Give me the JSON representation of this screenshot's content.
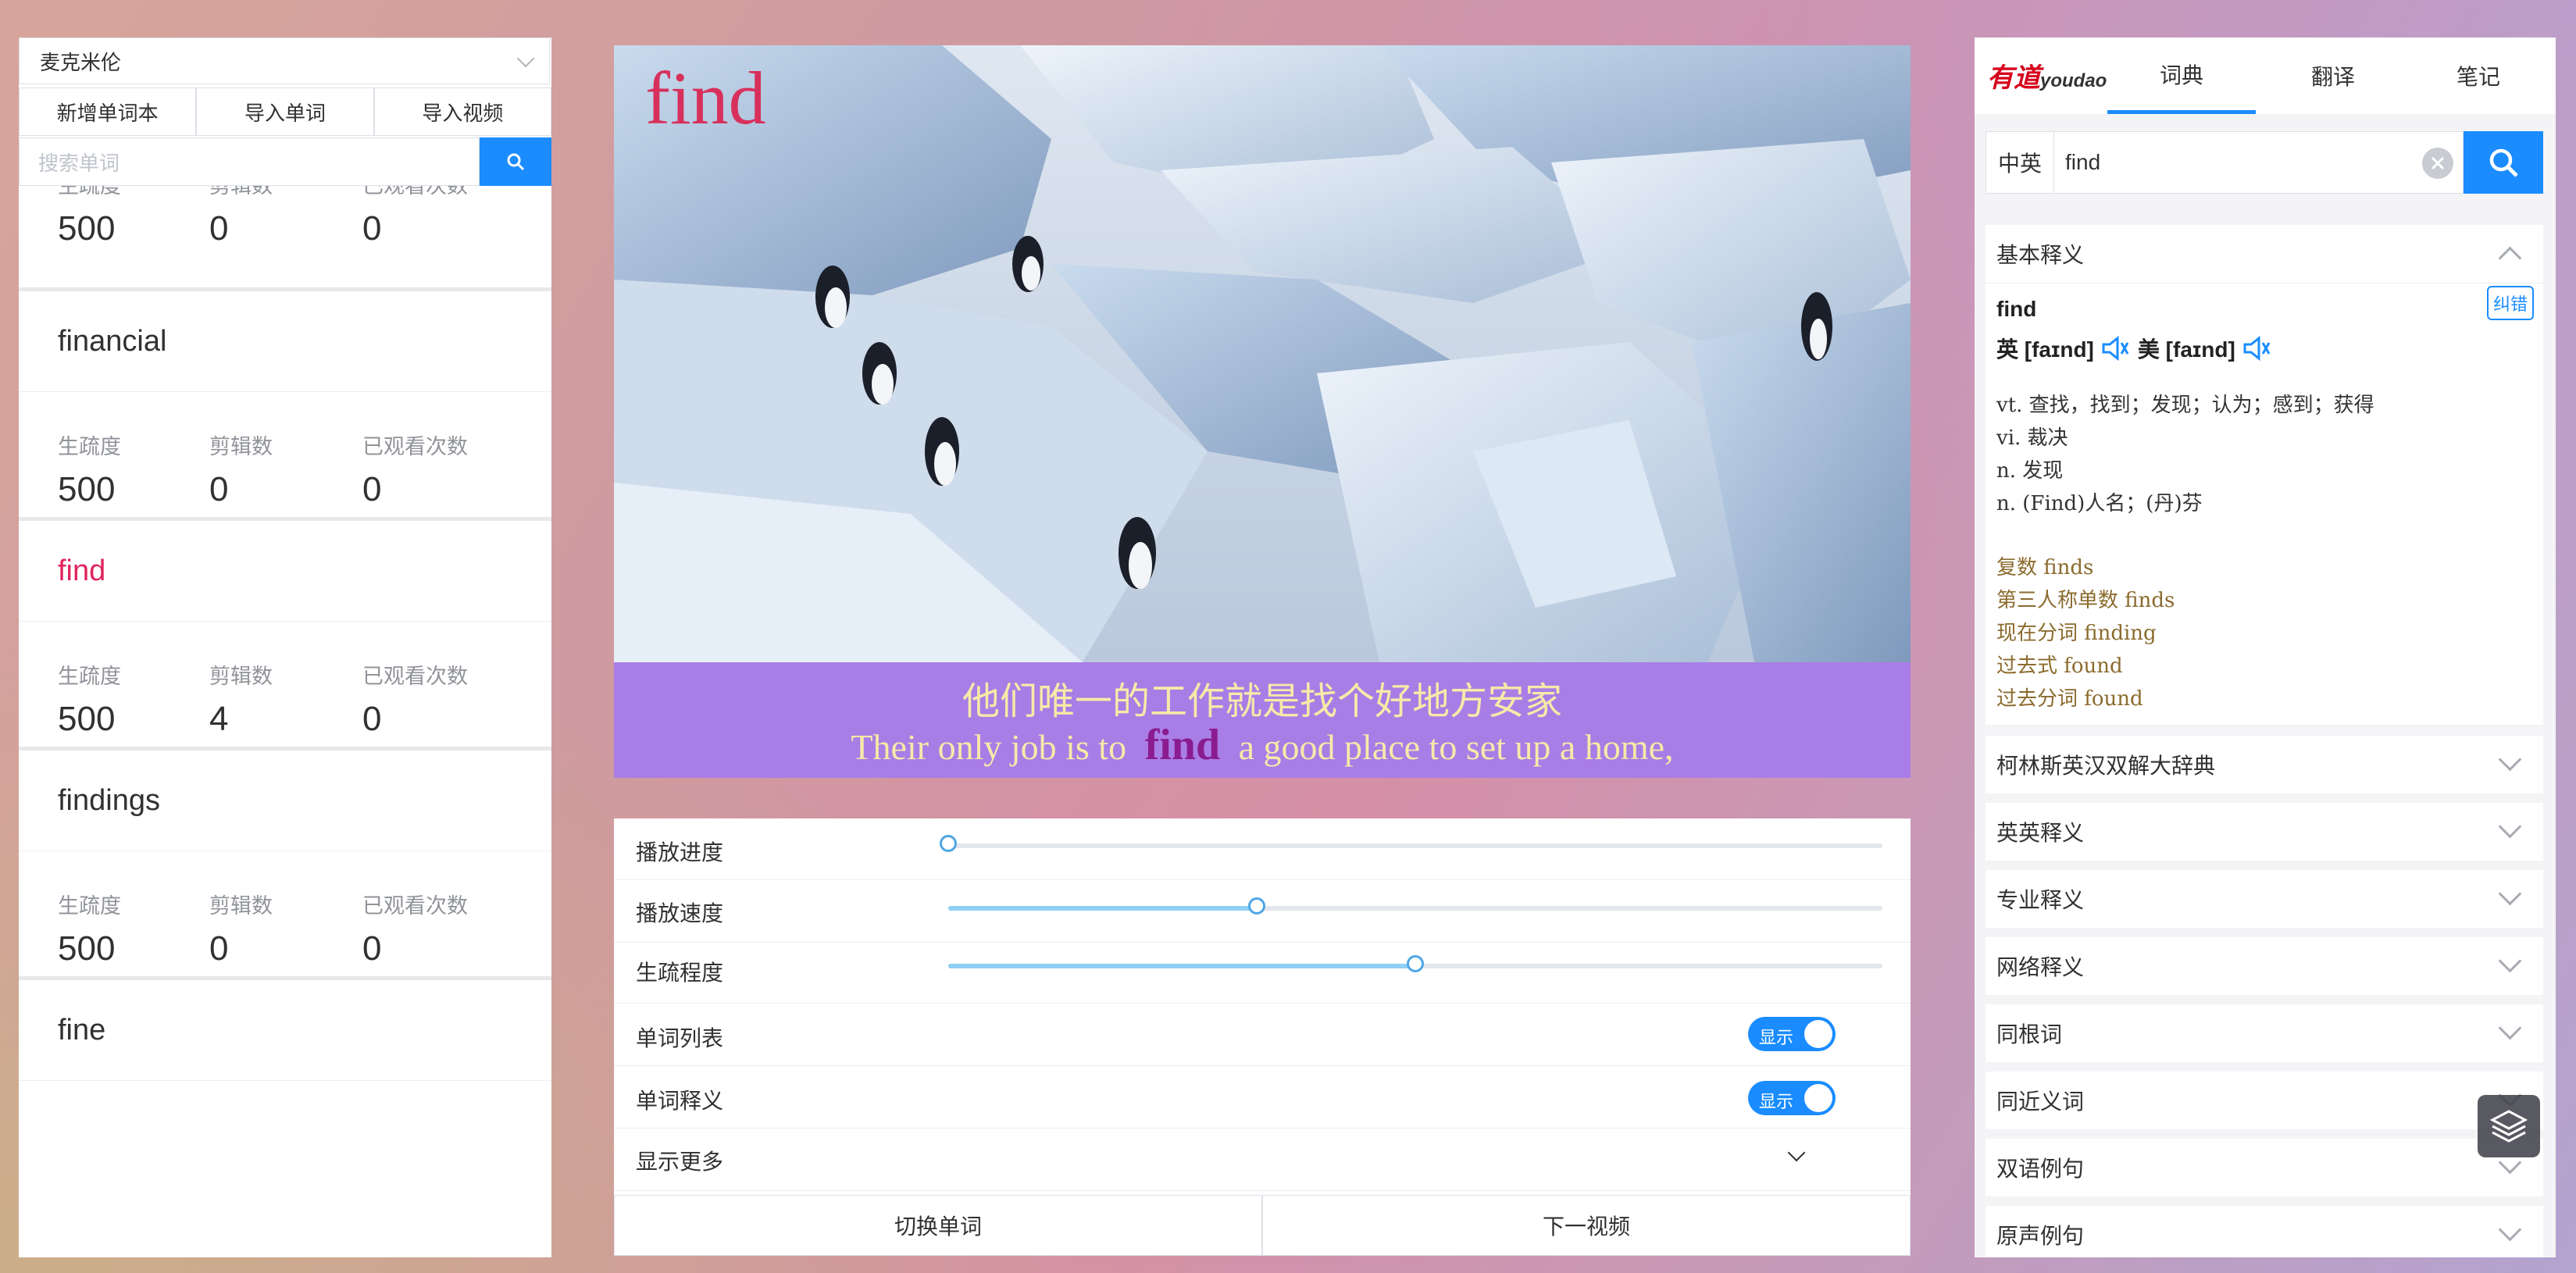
{
  "left": {
    "wordbook": "麦克米伦",
    "buttons": [
      "新增单词本",
      "导入单词",
      "导入视频"
    ],
    "search_placeholder": "搜索单词",
    "stat_labels": {
      "familiarity": "生疏度",
      "clips": "剪辑数",
      "views": "已观看次数"
    },
    "top_partial": {
      "familiarity": "500",
      "clips": "0",
      "views": "0"
    },
    "words": [
      {
        "word": "financial",
        "familiarity": "500",
        "clips": "0",
        "views": "0"
      },
      {
        "word": "find",
        "familiarity": "500",
        "clips": "4",
        "views": "0"
      },
      {
        "word": "findings",
        "familiarity": "500",
        "clips": "0",
        "views": "0"
      },
      {
        "word": "fine"
      }
    ]
  },
  "video": {
    "word": "find",
    "subtitle_cn": "他们唯一的工作就是找个好地方安家",
    "subtitle_en_before": "Their only job is to",
    "subtitle_en_word": "find",
    "subtitle_en_after": "a good place to set up a home,"
  },
  "controls": {
    "progress_label": "播放进度",
    "progress_value": 0,
    "speed_label": "播放速度",
    "speed_value": 0.33,
    "familiarity_label": "生疏程度",
    "familiarity_value": 0.5,
    "word_list_label": "单词列表",
    "word_list_toggle": "显示",
    "word_def_label": "单词释义",
    "word_def_toggle": "显示",
    "more_label": "显示更多",
    "switch_word": "切换单词",
    "next_video": "下一视频"
  },
  "dict": {
    "logo_cn": "有道",
    "logo_en": "youdao",
    "tabs": [
      "词典",
      "翻译",
      "笔记"
    ],
    "lang": "中英",
    "query": "find",
    "basic_title": "基本释义",
    "report": "纠错",
    "word": "find",
    "phonetic_uk": "英 [faɪnd]",
    "phonetic_us": "美 [faɪnd]",
    "definitions": [
      "vt. 查找，找到；发现；认为；感到；获得",
      "vi. 裁决",
      "n. 发现",
      "n. (Find)人名；(丹)芬"
    ],
    "inflections": [
      "复数 finds",
      "第三人称单数 finds",
      "现在分词 finding",
      "过去式 found",
      "过去分词 found"
    ],
    "sections": [
      "柯林斯英汉双解大辞典",
      "英英释义",
      "专业释义",
      "网络释义",
      "同根词",
      "同近义词",
      "双语例句",
      "原声例句"
    ]
  },
  "colors": {
    "accent": "#1a8cff",
    "active_word": "#e0245e",
    "subtitle_bg": "#a97de6",
    "subtitle_text": "#f7e9a8"
  }
}
